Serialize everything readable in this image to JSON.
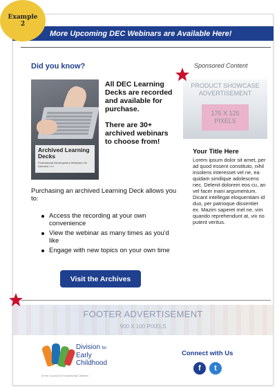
{
  "badge": {
    "line1": "Example",
    "line2": "2"
  },
  "banner": {
    "text": "More Upcoming DEC Webinars are Available Here!"
  },
  "intro": {
    "heading": "Did you know?",
    "sponsored": "Sponsored Content"
  },
  "deck_image": {
    "title": "Archived Learning Decks",
    "subtitle": "Professional Development Webinars On Demand >>>"
  },
  "feature": {
    "para1": "All DEC Learning Decks are recorded and available for purchase.",
    "para2": "There are 30+ archived webinars to choose from!"
  },
  "purchasing": "Purchasing an archived Learning Deck allows you to:",
  "bullets": [
    "Access the recording at your own convenience",
    "View the webinar as many times as you'd like",
    "Engage with new topics on your own time"
  ],
  "cta": {
    "label": "Visit the Archives"
  },
  "product_ad": {
    "title": "PRODUCT SHOWCASE ADVERTISEMENT",
    "size_line1": "175 X 125",
    "size_line2": "PIXELS"
  },
  "sidebar": {
    "title": "Your Title Here",
    "body": "Lorem ipsum dolor sit amet, per ad quod essent constituto, nihil insolens interesset vel ne, ea quidam similique adolescens nec. Delenit dolorem eos cu, an vel facer inani argumentum. Dicant intellegat eloquentiam id duo, per patrioque dissentiet ex. Mazim saperet mel ne, vim quando reprehendunt at, vix no putent veritus."
  },
  "footer_ad": {
    "title": "FOOTER ADVERTISEMENT",
    "size": "900 X 100 PIXELS"
  },
  "logo": {
    "line1": "Division",
    "line1_small": "for",
    "line2": "Early",
    "line3": "Childhood",
    "tagline": "of the Council for Exceptional Children"
  },
  "social": {
    "heading": "Connect with Us",
    "facebook": "f",
    "twitter": "t"
  },
  "colors": {
    "brand_blue": "#1f3f8f",
    "badge_yellow": "#efc63a",
    "star_red": "#c8102e"
  }
}
